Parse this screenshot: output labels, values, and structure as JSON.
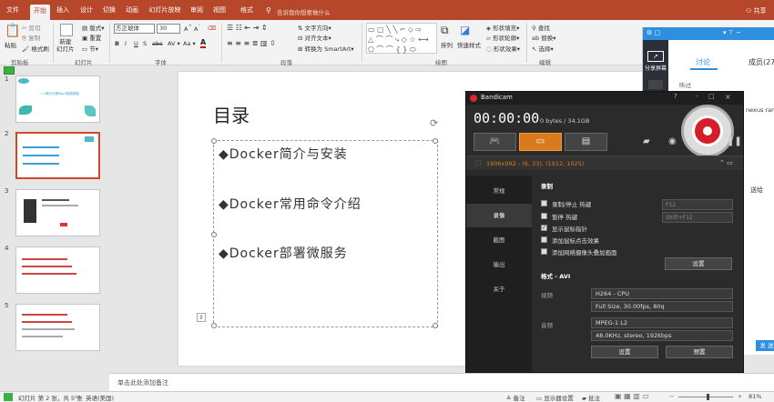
{
  "menu": {
    "tabs": [
      "文件",
      "开始",
      "插入",
      "设计",
      "切换",
      "动画",
      "幻灯片放映",
      "审阅",
      "视图",
      "格式"
    ],
    "search_placeholder": "告诉我你想要做什么",
    "share": "共享"
  },
  "ribbon": {
    "paste": "粘贴",
    "cut": "剪切",
    "copy": "复制",
    "format_painter": "格式刷",
    "new_slide": "新建\n幻灯片",
    "layout": "版式",
    "reset": "重置",
    "section": "节",
    "font_name": "方正琥体",
    "font_size": "30",
    "text_direction": "文字方向",
    "align_text": "对齐文本",
    "convert_smartart": "转换为 SmartArt",
    "arrange": "排列",
    "quick_styles": "快速样式",
    "shape_fill": "形状填充",
    "shape_outline": "形状轮廓",
    "shape_effects": "形状效果",
    "find": "查找",
    "replace": "替换",
    "select": "选择",
    "groups": [
      "剪贴板",
      "幻灯片",
      "字体",
      "段落",
      "绘图",
      "编辑"
    ]
  },
  "slide_panel": {
    "numbers": [
      "1",
      "2",
      "3",
      "4",
      "5"
    ],
    "thumb1_text": "一人简历大赛Word智能模板"
  },
  "slide": {
    "title": "目录",
    "items": [
      "◆Docker简介与安装",
      "◆Docker常用命令介绍",
      "◆Docker部署微服务"
    ]
  },
  "notes_placeholder": "单击此处添加备注",
  "status": {
    "slide_info": "幻灯片 第 2 张，共 5 张",
    "language": "英语(美国)",
    "notes": "备注",
    "display": "显示器设置",
    "comments": "批注",
    "zoom": "81%"
  },
  "bandicam": {
    "title": "Bandicam",
    "time": "00:00:00",
    "size": "0 bytes / 34.1GB",
    "region": "1906x992 - (6, 33), (1912, 1025)",
    "sidebar": [
      "常规",
      "录像",
      "截图",
      "输出",
      "关于"
    ],
    "section_record": "录制",
    "options": [
      "录制/停止 热键",
      "暂停 热键",
      "显示鼠标指针",
      "添加鼠标点击效果",
      "添加网络摄像头叠加画面"
    ],
    "hotkey1": "F12",
    "hotkey2": "Shift+F12",
    "settings_btn": "设置",
    "format_label": "格式 - AVI",
    "video_label": "视频",
    "video_codec": "H264 - CPU",
    "video_detail": "Full Size, 30.00fps, 80q",
    "audio_label": "音频",
    "audio_codec": "MPEG-1 L2",
    "audio_detail": "48.0KHz, stereo, 192kbps",
    "settings2": "设置",
    "presets": "预置",
    "window_btns": [
      "?",
      "-",
      "□",
      "×"
    ],
    "checked": [
      false,
      false,
      true,
      false,
      false
    ]
  },
  "chat": {
    "share_screen": "分享屏幕",
    "tab_discuss": "讨论",
    "tab_members": "成员(27",
    "listen": "听过",
    "msg1": "nexus ran",
    "msg2": "送给",
    "send": "发 送",
    "colors": {
      "accent": "#2f8fdf"
    }
  },
  "colors": {
    "ppt_red": "#b7472a",
    "slide_accent": "#3a9fd8"
  }
}
